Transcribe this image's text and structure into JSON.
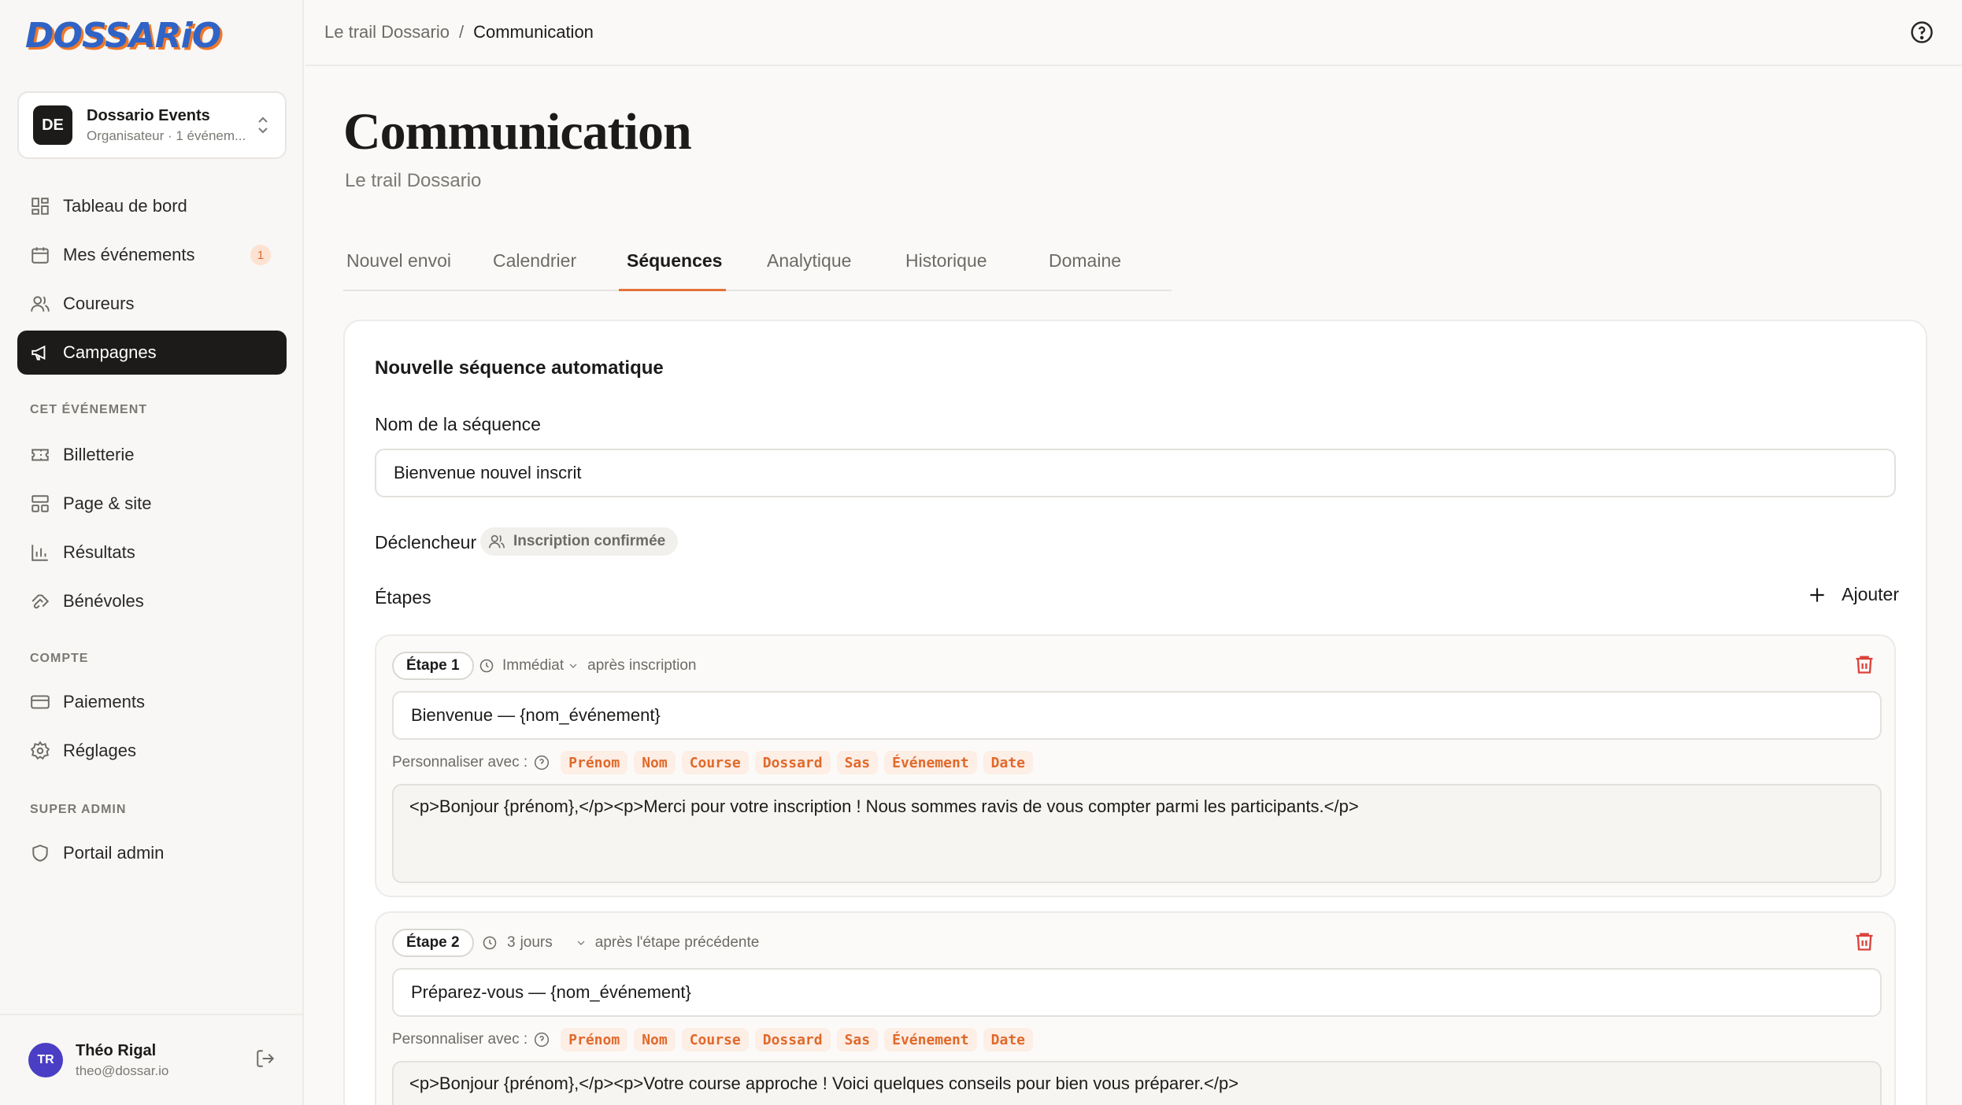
{
  "brand": {
    "logo_text": "DOSSARiO"
  },
  "org": {
    "initials": "DE",
    "name": "Dossario Events",
    "subtitle": "Organisateur · 1 événem..."
  },
  "nav": {
    "main": [
      {
        "label": "Tableau de bord"
      },
      {
        "label": "Mes événements",
        "badge": "1"
      },
      {
        "label": "Coureurs"
      },
      {
        "label": "Campagnes"
      }
    ],
    "event_section_label": "CET ÉVÉNEMENT",
    "event": [
      {
        "label": "Billetterie"
      },
      {
        "label": "Page & site"
      },
      {
        "label": "Résultats"
      },
      {
        "label": "Bénévoles"
      }
    ],
    "account_section_label": "COMPTE",
    "account": [
      {
        "label": "Paiements"
      },
      {
        "label": "Réglages"
      }
    ],
    "admin_section_label": "SUPER ADMIN",
    "admin": [
      {
        "label": "Portail admin"
      }
    ]
  },
  "user": {
    "initials": "TR",
    "name": "Théo Rigal",
    "email": "theo@dossar.io"
  },
  "breadcrumb": {
    "parent": "Le trail Dossario",
    "separator": "/",
    "current": "Communication"
  },
  "page": {
    "title": "Communication",
    "subtitle": "Le trail Dossario"
  },
  "tabs": [
    {
      "label": "Nouvel envoi"
    },
    {
      "label": "Calendrier"
    },
    {
      "label": "Séquences",
      "active": true
    },
    {
      "label": "Analytique"
    },
    {
      "label": "Historique"
    },
    {
      "label": "Domaine"
    }
  ],
  "sequence": {
    "card_title": "Nouvelle séquence automatique",
    "name_label": "Nom de la séquence",
    "name_value": "Bienvenue nouvel inscrit",
    "trigger_label": "Déclencheur",
    "trigger_value": "Inscription confirmée",
    "steps_label": "Étapes",
    "add_label": "Ajouter",
    "personalize_label": "Personnaliser avec :",
    "tags": [
      "Prénom",
      "Nom",
      "Course",
      "Dossard",
      "Sas",
      "Événement",
      "Date"
    ],
    "steps": [
      {
        "badge": "Étape 1",
        "delay": "Immédiat",
        "relation": "après inscription",
        "subject": "Bienvenue — {nom_événement}",
        "body": "<p>Bonjour {prénom},</p><p>Merci pour votre inscription ! Nous sommes ravis de vous compter parmi les participants.</p>"
      },
      {
        "badge": "Étape 2",
        "delay": "3",
        "delay_unit": "jours",
        "relation": "après l'étape précédente",
        "subject": "Préparez-vous — {nom_événement}",
        "body": "<p>Bonjour {prénom},</p><p>Votre course approche ! Voici quelques conseils pour bien vous préparer.</p>"
      }
    ]
  },
  "colors": {
    "accent": "#e4723a",
    "active_nav_bg": "#1c1b1a",
    "danger": "#d9433a",
    "tag_bg": "#fdeee6",
    "tag_text": "#e0692a"
  }
}
